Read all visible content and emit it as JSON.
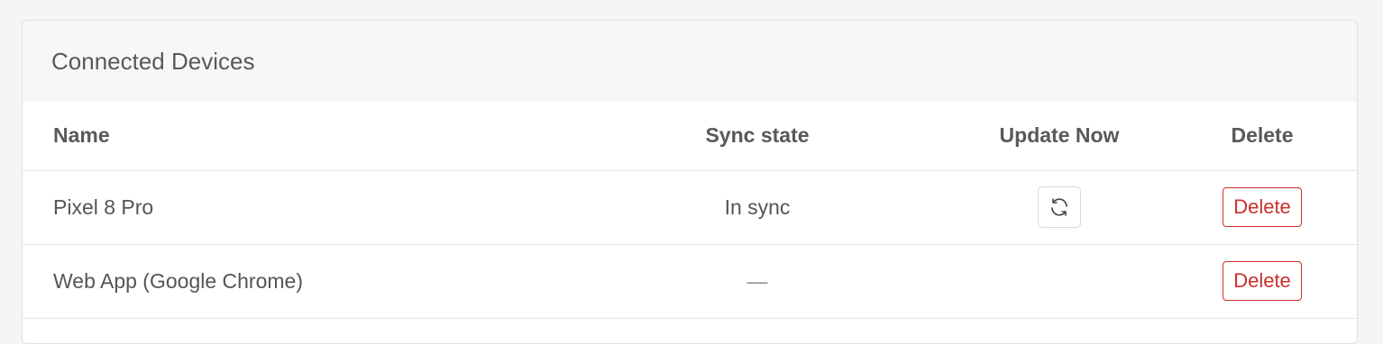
{
  "panel": {
    "title": "Connected Devices"
  },
  "table": {
    "headers": {
      "name": "Name",
      "sync_state": "Sync state",
      "update_now": "Update Now",
      "delete": "Delete"
    },
    "rows": [
      {
        "name": "Pixel 8 Pro",
        "sync_state": "In sync",
        "has_update_button": true,
        "delete_label": "Delete"
      },
      {
        "name": "Web App (Google Chrome)",
        "sync_state": "—",
        "has_update_button": false,
        "delete_label": "Delete"
      }
    ]
  },
  "icons": {
    "refresh": "refresh-icon"
  },
  "colors": {
    "delete_accent": "#c9302c",
    "header_background": "#f7f7f7"
  }
}
